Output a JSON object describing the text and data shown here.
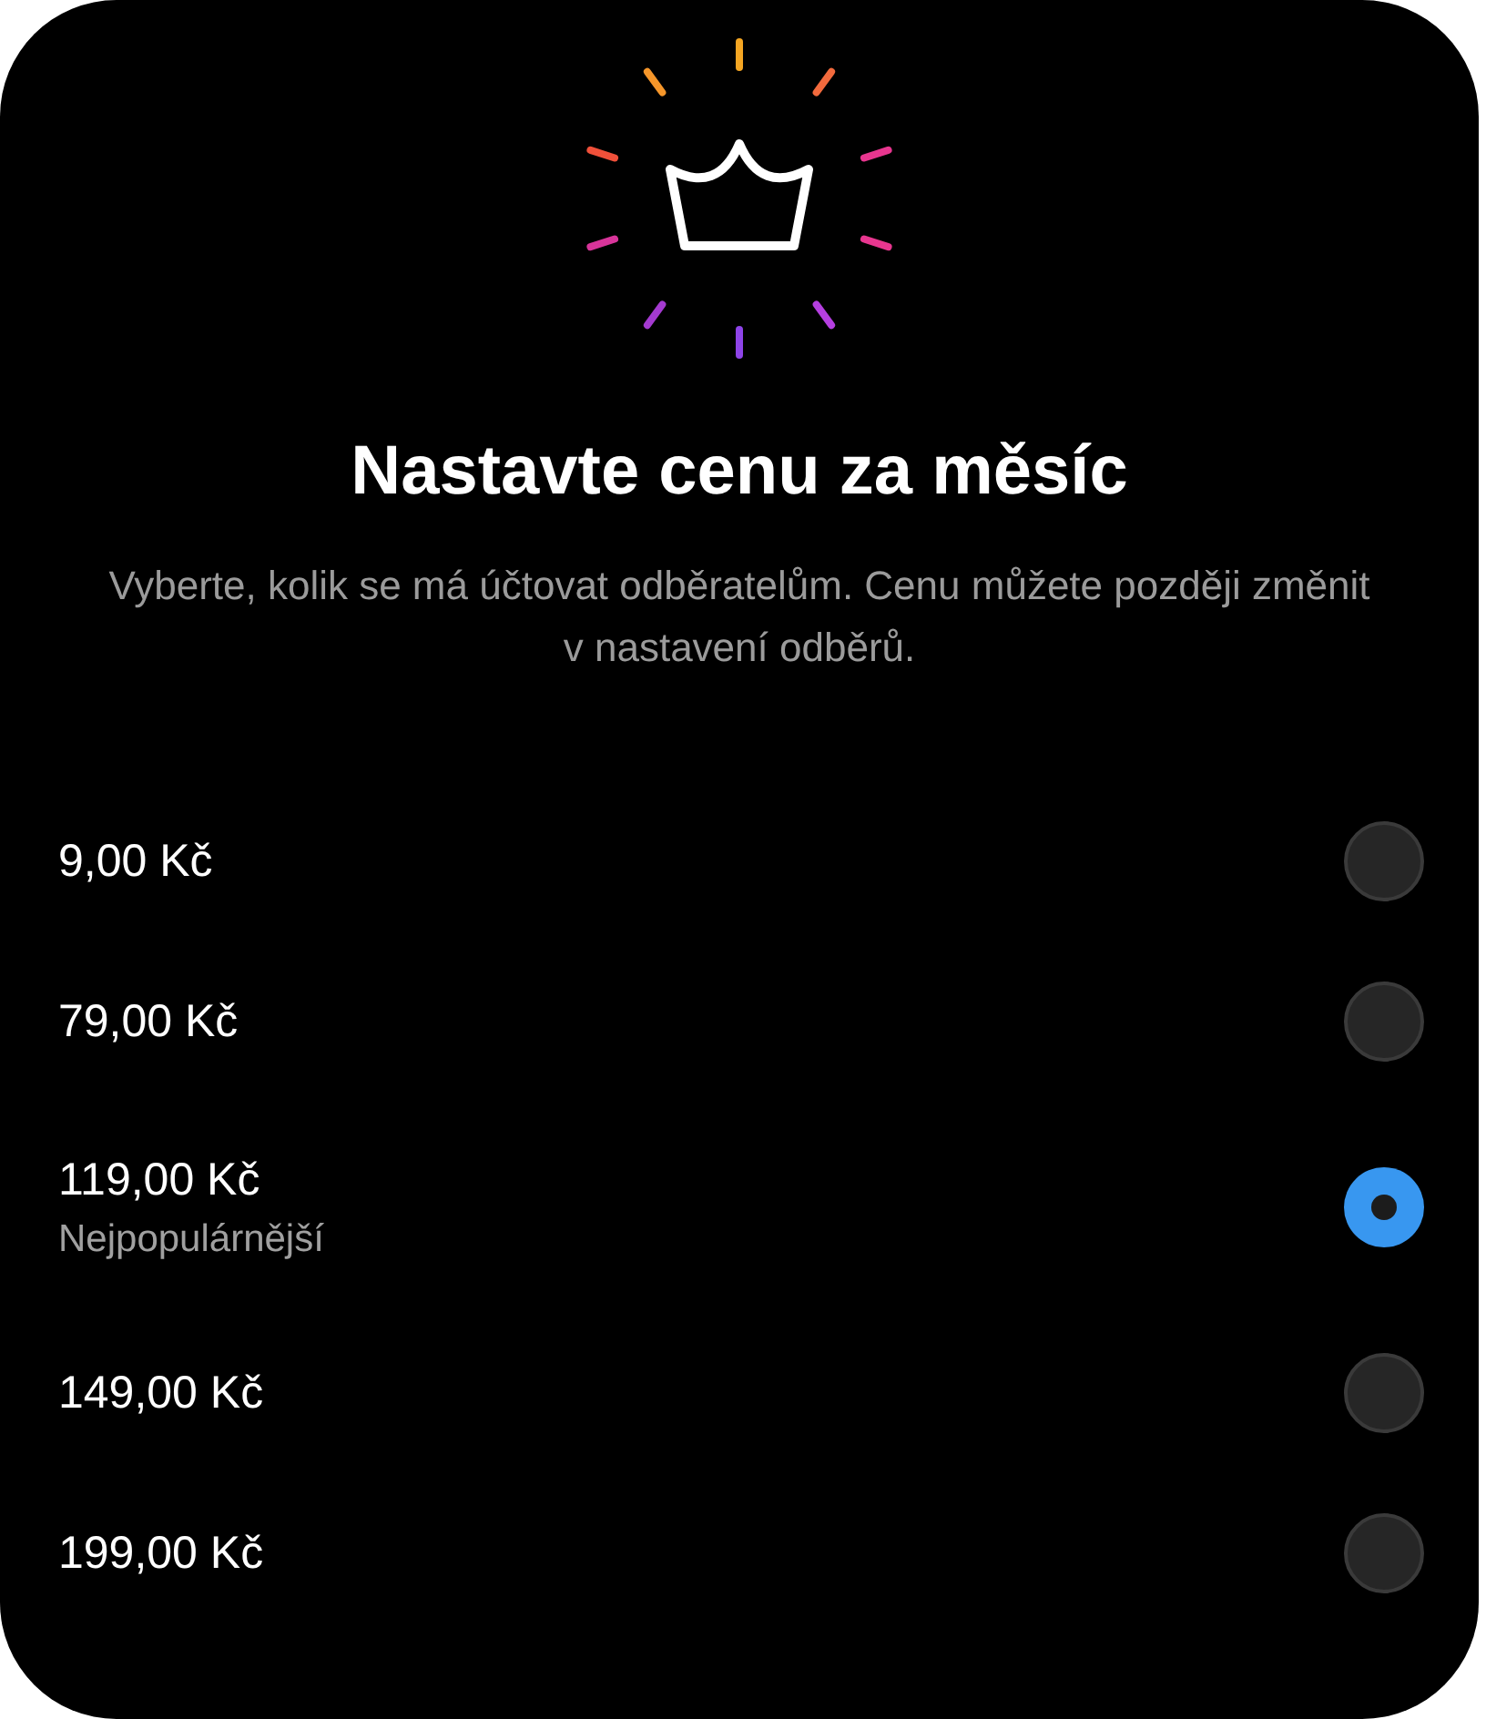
{
  "title": "Nastavte cenu za měsíc",
  "description": "Vyberte, kolik se má účtovat odběratelům. Cenu můžete později změnit v nastavení odběrů.",
  "options": [
    {
      "price": "9,00 Kč",
      "selected": false
    },
    {
      "price": "79,00 Kč",
      "selected": false
    },
    {
      "price": "119,00 Kč",
      "note": "Nejpopulárnější",
      "selected": true
    },
    {
      "price": "149,00 Kč",
      "selected": false
    },
    {
      "price": "199,00 Kč",
      "selected": false
    }
  ]
}
